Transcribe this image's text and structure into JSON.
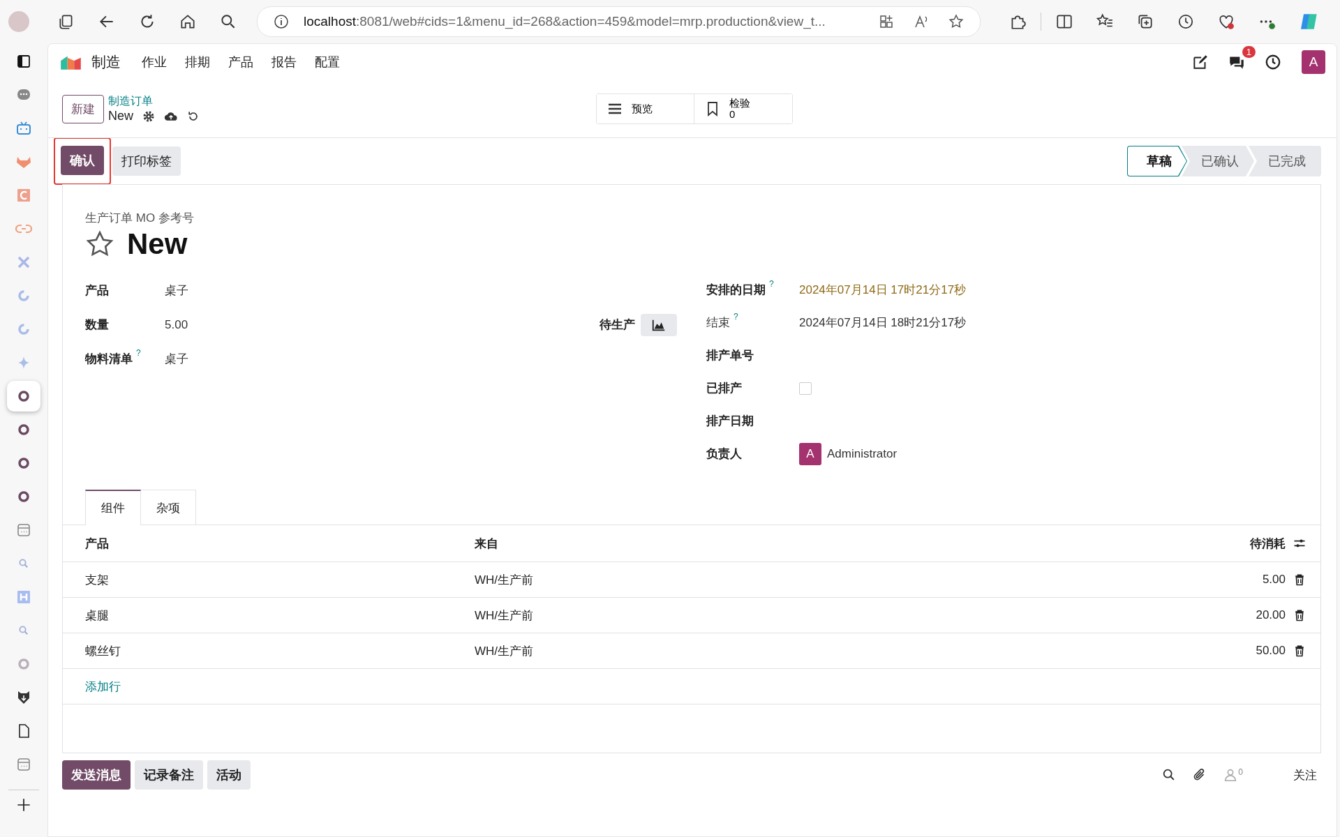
{
  "browser": {
    "url_host": "localhost",
    "url_rest": ":8081/web#cids=1&menu_id=268&action=459&model=mrp.production&view_t..."
  },
  "sidebar": {
    "items": [
      {
        "kind": "panel",
        "selected": false
      },
      {
        "kind": "bubble",
        "selected": false
      },
      {
        "kind": "tv",
        "selected": false
      },
      {
        "kind": "fox",
        "selected": false
      },
      {
        "kind": "csquare",
        "selected": false
      },
      {
        "kind": "link",
        "selected": false
      },
      {
        "kind": "x",
        "selected": false
      },
      {
        "kind": "cring",
        "selected": false
      },
      {
        "kind": "cring",
        "selected": false
      },
      {
        "kind": "sparkle",
        "selected": false
      },
      {
        "kind": "ring",
        "selected": true
      },
      {
        "kind": "ring",
        "selected": false
      },
      {
        "kind": "ring",
        "selected": false
      },
      {
        "kind": "ring",
        "selected": false
      },
      {
        "kind": "calendar",
        "selected": false
      },
      {
        "kind": "search",
        "selected": false
      },
      {
        "kind": "hsquare",
        "selected": false
      },
      {
        "kind": "search",
        "selected": false
      },
      {
        "kind": "ringlight",
        "selected": false
      },
      {
        "kind": "shield",
        "selected": false
      },
      {
        "kind": "file",
        "selected": false
      },
      {
        "kind": "calendar",
        "selected": false
      }
    ]
  },
  "navbar": {
    "app": "制造",
    "menus": [
      "作业",
      "排期",
      "产品",
      "报告",
      "配置"
    ],
    "chat_badge": "1",
    "avatar": "A"
  },
  "control_panel": {
    "new_button": "新建",
    "breadcrumb": "制造订单",
    "record": "New",
    "smart_buttons": [
      {
        "kind": "list",
        "label": "预览"
      },
      {
        "kind": "bookmark",
        "label": "检验",
        "value": "0"
      }
    ]
  },
  "actions": [
    {
      "label": "确认",
      "primary": true,
      "highlighted": true
    },
    {
      "label": "打印标签",
      "primary": false,
      "highlighted": false
    }
  ],
  "statusbar": [
    {
      "label": "草稿",
      "selected": true
    },
    {
      "label": "已确认",
      "selected": false
    },
    {
      "label": "已完成",
      "selected": false
    }
  ],
  "form": {
    "ref_label": "生产订单 MO 参考号",
    "title": "New",
    "starred": false,
    "left_fields": [
      {
        "label": "产品",
        "value": "桌子"
      },
      {
        "label": "数量",
        "value": "5.00"
      },
      {
        "label": "物料清单",
        "value": "桌子",
        "help": "?"
      }
    ],
    "forecast_label": "待生产",
    "right_fields": [
      {
        "kind": "text",
        "label": "安排的日期",
        "value": "2024年07月14日 17时21分17秒",
        "help": "?",
        "warning": true,
        "muted": false
      },
      {
        "kind": "text",
        "label": "结束",
        "value": "2024年07月14日 18时21分17秒",
        "help": "?",
        "warning": false,
        "muted": true
      },
      {
        "kind": "text",
        "label": "排产单号",
        "muted": false
      },
      {
        "kind": "checkbox",
        "label": "已排产",
        "checked": false,
        "muted": false
      },
      {
        "kind": "text",
        "label": "排产日期",
        "muted": false
      },
      {
        "kind": "user",
        "label": "负责人",
        "avatar": "A",
        "value": "Administrator",
        "muted": false
      }
    ],
    "tabs": [
      {
        "label": "组件",
        "selected": true
      },
      {
        "label": "杂项",
        "selected": false
      }
    ],
    "table": {
      "columns": [
        "产品",
        "来自",
        "待消耗"
      ],
      "rows": [
        {
          "product": "支架",
          "from": "WH/生产前",
          "qty": "5.00"
        },
        {
          "product": "桌腿",
          "from": "WH/生产前",
          "qty": "20.00"
        },
        {
          "product": "螺丝钉",
          "from": "WH/生产前",
          "qty": "50.00"
        }
      ],
      "add_line": "添加行"
    }
  },
  "chatter": {
    "buttons": [
      {
        "label": "发送消息",
        "primary": true
      },
      {
        "label": "记录备注",
        "primary": false
      },
      {
        "label": "活动",
        "primary": false
      }
    ],
    "followers": "0",
    "follow": "关注"
  }
}
